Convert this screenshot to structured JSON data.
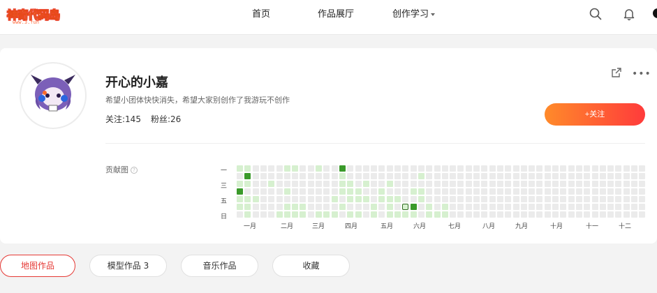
{
  "header": {
    "logo_text": "神奇代码岛",
    "logo_sub": "www.3.fun",
    "nav": [
      "首页",
      "作品展厅",
      "创作学习"
    ]
  },
  "profile": {
    "username": "开心的小嘉",
    "bio": "希望小团体快快消失，希望大家别创作了我游玩不创作",
    "following_label": "关注:145",
    "followers_label": "粉丝:26",
    "follow_button": "+关注"
  },
  "contributions": {
    "label": "贡献图",
    "day_labels": [
      "一",
      "三",
      "五",
      "日"
    ],
    "months": [
      "一月",
      "二月",
      "三月",
      "四月",
      "五月",
      "六月",
      "七月",
      "八月",
      "九月",
      "十月",
      "十一",
      "十二"
    ],
    "levels": {
      "light": [
        [
          0,
          0
        ],
        [
          0,
          2
        ],
        [
          0,
          3
        ],
        [
          0,
          4
        ],
        [
          0,
          5
        ],
        [
          1,
          0
        ],
        [
          1,
          2
        ],
        [
          1,
          4
        ],
        [
          1,
          5
        ],
        [
          1,
          6
        ],
        [
          2,
          4
        ],
        [
          4,
          2
        ],
        [
          6,
          0
        ],
        [
          6,
          3
        ],
        [
          6,
          5
        ],
        [
          6,
          6
        ],
        [
          5,
          6
        ],
        [
          7,
          0
        ],
        [
          7,
          5
        ],
        [
          7,
          6
        ],
        [
          8,
          5
        ],
        [
          8,
          6
        ],
        [
          10,
          0
        ],
        [
          10,
          6
        ],
        [
          11,
          6
        ],
        [
          12,
          4
        ],
        [
          12,
          6
        ],
        [
          13,
          1
        ],
        [
          13,
          2
        ],
        [
          13,
          3
        ],
        [
          13,
          5
        ],
        [
          14,
          2
        ],
        [
          14,
          3
        ],
        [
          14,
          4
        ],
        [
          14,
          6
        ],
        [
          15,
          3
        ],
        [
          15,
          4
        ],
        [
          15,
          6
        ],
        [
          16,
          2
        ],
        [
          16,
          4
        ],
        [
          17,
          5
        ],
        [
          17,
          6
        ],
        [
          18,
          3
        ],
        [
          18,
          4
        ],
        [
          19,
          2
        ],
        [
          19,
          4
        ],
        [
          19,
          5
        ],
        [
          19,
          6
        ],
        [
          20,
          4
        ],
        [
          20,
          6
        ],
        [
          21,
          5
        ],
        [
          21,
          6
        ],
        [
          22,
          3
        ],
        [
          22,
          6
        ],
        [
          23,
          1
        ],
        [
          23,
          3
        ],
        [
          23,
          4
        ],
        [
          24,
          5
        ],
        [
          24,
          6
        ],
        [
          25,
          6
        ],
        [
          26,
          5
        ],
        [
          26,
          6
        ]
      ],
      "dark": [
        [
          0,
          3
        ],
        [
          1,
          1
        ],
        [
          13,
          0
        ],
        [
          22,
          5
        ]
      ],
      "today": [
        21,
        5
      ]
    },
    "legend_colors": {
      "empty": "#ebebeb",
      "light": "#d6f0cf",
      "mid": "#9bd58d",
      "dark": "#3a9a2a"
    }
  },
  "tabs": [
    {
      "label": "地图作品",
      "active": true
    },
    {
      "label": "模型作品 3",
      "active": false
    },
    {
      "label": "音乐作品",
      "active": false
    },
    {
      "label": "收藏",
      "active": false
    }
  ],
  "colors": {
    "accent": "#e53935",
    "follow_start": "#ff8a2a",
    "follow_end": "#ff3b3b"
  }
}
